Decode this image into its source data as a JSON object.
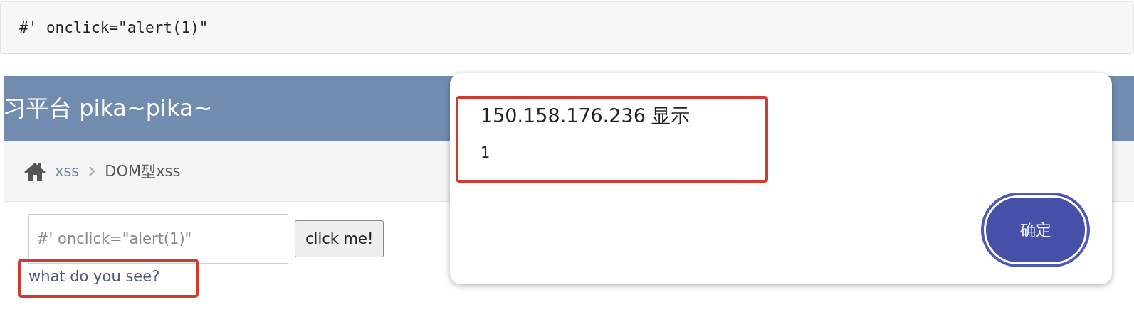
{
  "code_block": {
    "text": "#' onclick=\"alert(1)\""
  },
  "page": {
    "header_title": "习平台 pika~pika~",
    "breadcrumb": [
      {
        "label": "xss",
        "kind": "link"
      },
      {
        "label": "DOM型xss",
        "kind": "current"
      }
    ],
    "input": {
      "value": "#' onclick=\"alert(1)\""
    },
    "button": "click me!",
    "link": {
      "label": "what do you see?",
      "highlighted": true
    }
  },
  "alert": {
    "title": "150.158.176.236 显示",
    "message": "1",
    "highlighted": true,
    "button": "确定"
  }
}
